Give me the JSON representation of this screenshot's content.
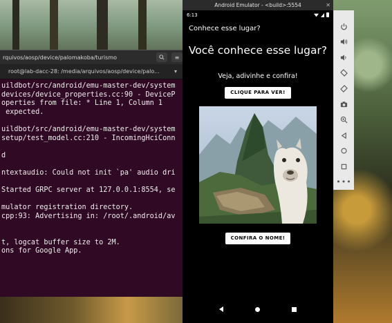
{
  "terminal": {
    "window_title": "rquivos/aosp/device/palomakoba/turismo",
    "tab_title": "root@lab-dacc-28: /media/arquivos/aosp/device/palo...",
    "lines": [
      "uildbot/src/android/emu-master-dev/system",
      "devices/device_properties.cc:90 - DeviceP",
      "operties from file: * Line 1, Column 1",
      " expected.",
      "",
      "uildbot/src/android/emu-master-dev/system",
      "setup/test_model.cc:210 - IncomingHciConn",
      "",
      "d",
      "",
      "ntextaudio: Could not init `pa' audio dri",
      "",
      "Started GRPC server at 127.0.0.1:8554, se",
      "",
      "mulator registration directory.",
      "cpp:93: Advertising in: /root/.android/av",
      "",
      "",
      "t, logcat buffer size to 2M.",
      "ons for Google App."
    ]
  },
  "emulator": {
    "window_title": "Android Emulator - <build>:5554",
    "status_time": "6:13",
    "app_title": "Conhece esse lugar?",
    "headline": "Você conhece esse lugar?",
    "subline": "Veja, adivinhe e confira!",
    "reveal_button": "CLIQUE PARA VER!",
    "name_button": "CONFIRA O NOME!"
  },
  "toolbar": {
    "tools": [
      "power-icon",
      "volume-up-icon",
      "volume-down-icon",
      "rotate-left-icon",
      "rotate-right-icon",
      "camera-icon",
      "zoom-in-icon",
      "back-icon",
      "home-icon",
      "overview-icon",
      "more-icon"
    ]
  }
}
